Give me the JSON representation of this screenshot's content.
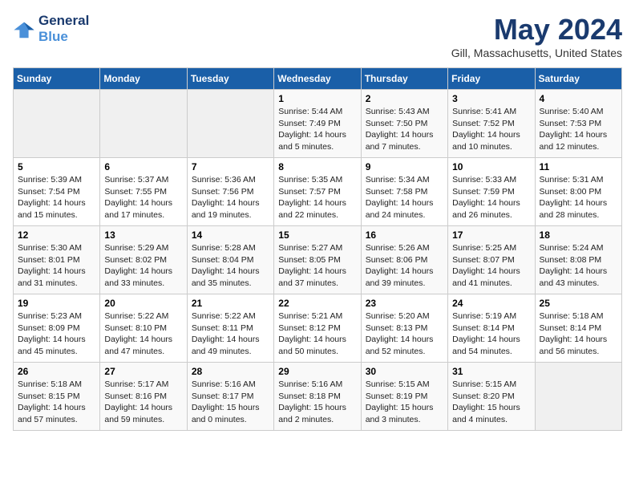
{
  "header": {
    "logo_line1": "General",
    "logo_line2": "Blue",
    "title": "May 2024",
    "subtitle": "Gill, Massachusetts, United States"
  },
  "days_of_week": [
    "Sunday",
    "Monday",
    "Tuesday",
    "Wednesday",
    "Thursday",
    "Friday",
    "Saturday"
  ],
  "weeks": [
    {
      "days": [
        {
          "num": "",
          "info": ""
        },
        {
          "num": "",
          "info": ""
        },
        {
          "num": "",
          "info": ""
        },
        {
          "num": "1",
          "info": "Sunrise: 5:44 AM\nSunset: 7:49 PM\nDaylight: 14 hours\nand 5 minutes."
        },
        {
          "num": "2",
          "info": "Sunrise: 5:43 AM\nSunset: 7:50 PM\nDaylight: 14 hours\nand 7 minutes."
        },
        {
          "num": "3",
          "info": "Sunrise: 5:41 AM\nSunset: 7:52 PM\nDaylight: 14 hours\nand 10 minutes."
        },
        {
          "num": "4",
          "info": "Sunrise: 5:40 AM\nSunset: 7:53 PM\nDaylight: 14 hours\nand 12 minutes."
        }
      ]
    },
    {
      "days": [
        {
          "num": "5",
          "info": "Sunrise: 5:39 AM\nSunset: 7:54 PM\nDaylight: 14 hours\nand 15 minutes."
        },
        {
          "num": "6",
          "info": "Sunrise: 5:37 AM\nSunset: 7:55 PM\nDaylight: 14 hours\nand 17 minutes."
        },
        {
          "num": "7",
          "info": "Sunrise: 5:36 AM\nSunset: 7:56 PM\nDaylight: 14 hours\nand 19 minutes."
        },
        {
          "num": "8",
          "info": "Sunrise: 5:35 AM\nSunset: 7:57 PM\nDaylight: 14 hours\nand 22 minutes."
        },
        {
          "num": "9",
          "info": "Sunrise: 5:34 AM\nSunset: 7:58 PM\nDaylight: 14 hours\nand 24 minutes."
        },
        {
          "num": "10",
          "info": "Sunrise: 5:33 AM\nSunset: 7:59 PM\nDaylight: 14 hours\nand 26 minutes."
        },
        {
          "num": "11",
          "info": "Sunrise: 5:31 AM\nSunset: 8:00 PM\nDaylight: 14 hours\nand 28 minutes."
        }
      ]
    },
    {
      "days": [
        {
          "num": "12",
          "info": "Sunrise: 5:30 AM\nSunset: 8:01 PM\nDaylight: 14 hours\nand 31 minutes."
        },
        {
          "num": "13",
          "info": "Sunrise: 5:29 AM\nSunset: 8:02 PM\nDaylight: 14 hours\nand 33 minutes."
        },
        {
          "num": "14",
          "info": "Sunrise: 5:28 AM\nSunset: 8:04 PM\nDaylight: 14 hours\nand 35 minutes."
        },
        {
          "num": "15",
          "info": "Sunrise: 5:27 AM\nSunset: 8:05 PM\nDaylight: 14 hours\nand 37 minutes."
        },
        {
          "num": "16",
          "info": "Sunrise: 5:26 AM\nSunset: 8:06 PM\nDaylight: 14 hours\nand 39 minutes."
        },
        {
          "num": "17",
          "info": "Sunrise: 5:25 AM\nSunset: 8:07 PM\nDaylight: 14 hours\nand 41 minutes."
        },
        {
          "num": "18",
          "info": "Sunrise: 5:24 AM\nSunset: 8:08 PM\nDaylight: 14 hours\nand 43 minutes."
        }
      ]
    },
    {
      "days": [
        {
          "num": "19",
          "info": "Sunrise: 5:23 AM\nSunset: 8:09 PM\nDaylight: 14 hours\nand 45 minutes."
        },
        {
          "num": "20",
          "info": "Sunrise: 5:22 AM\nSunset: 8:10 PM\nDaylight: 14 hours\nand 47 minutes."
        },
        {
          "num": "21",
          "info": "Sunrise: 5:22 AM\nSunset: 8:11 PM\nDaylight: 14 hours\nand 49 minutes."
        },
        {
          "num": "22",
          "info": "Sunrise: 5:21 AM\nSunset: 8:12 PM\nDaylight: 14 hours\nand 50 minutes."
        },
        {
          "num": "23",
          "info": "Sunrise: 5:20 AM\nSunset: 8:13 PM\nDaylight: 14 hours\nand 52 minutes."
        },
        {
          "num": "24",
          "info": "Sunrise: 5:19 AM\nSunset: 8:14 PM\nDaylight: 14 hours\nand 54 minutes."
        },
        {
          "num": "25",
          "info": "Sunrise: 5:18 AM\nSunset: 8:14 PM\nDaylight: 14 hours\nand 56 minutes."
        }
      ]
    },
    {
      "days": [
        {
          "num": "26",
          "info": "Sunrise: 5:18 AM\nSunset: 8:15 PM\nDaylight: 14 hours\nand 57 minutes."
        },
        {
          "num": "27",
          "info": "Sunrise: 5:17 AM\nSunset: 8:16 PM\nDaylight: 14 hours\nand 59 minutes."
        },
        {
          "num": "28",
          "info": "Sunrise: 5:16 AM\nSunset: 8:17 PM\nDaylight: 15 hours\nand 0 minutes."
        },
        {
          "num": "29",
          "info": "Sunrise: 5:16 AM\nSunset: 8:18 PM\nDaylight: 15 hours\nand 2 minutes."
        },
        {
          "num": "30",
          "info": "Sunrise: 5:15 AM\nSunset: 8:19 PM\nDaylight: 15 hours\nand 3 minutes."
        },
        {
          "num": "31",
          "info": "Sunrise: 5:15 AM\nSunset: 8:20 PM\nDaylight: 15 hours\nand 4 minutes."
        },
        {
          "num": "",
          "info": ""
        }
      ]
    }
  ]
}
